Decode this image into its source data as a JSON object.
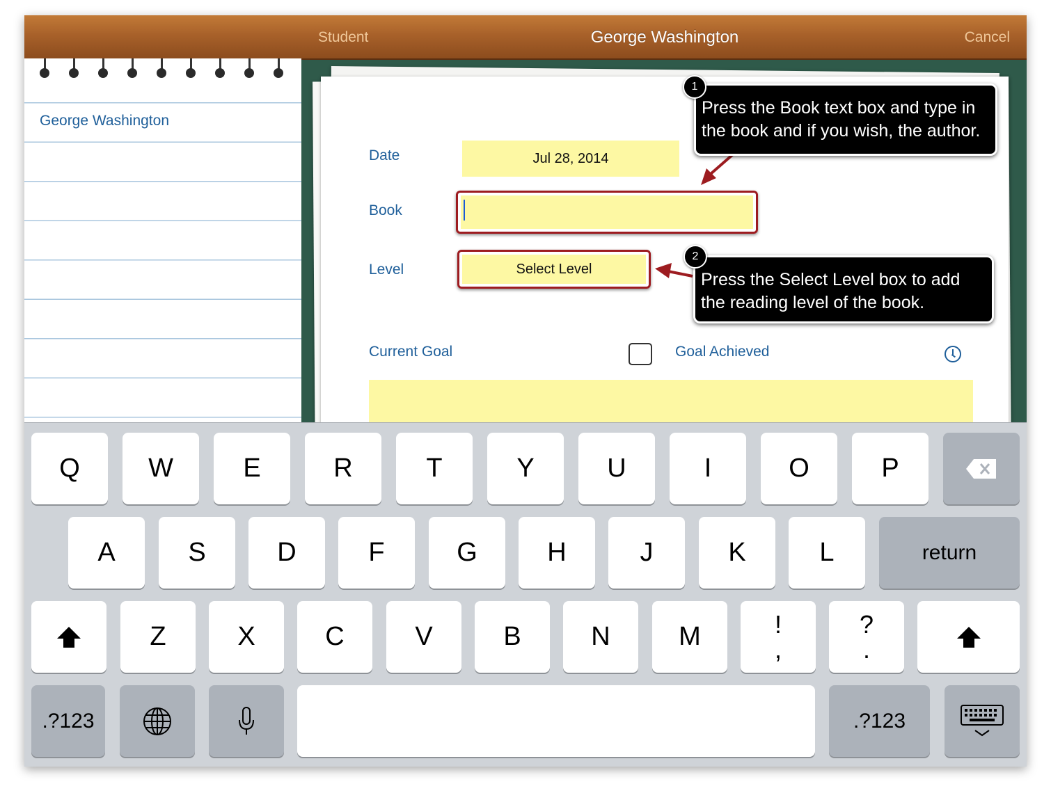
{
  "navbar": {
    "back_label": "Student",
    "title": "George Washington",
    "cancel_label": "Cancel"
  },
  "sidebar": {
    "items": [
      {
        "label": "George Washington"
      }
    ]
  },
  "form": {
    "date_label": "Date",
    "date_value": "Jul 28, 2014",
    "book_label": "Book",
    "book_value": "",
    "level_label": "Level",
    "level_value": "Select Level",
    "current_goal_label": "Current Goal",
    "goal_achieved_label": "Goal Achieved",
    "goal_achieved_checked": false
  },
  "callouts": [
    {
      "number": "1",
      "text": "Press the Book text box and type in the book and if you wish, the author."
    },
    {
      "number": "2",
      "text": "Press the Select Level box to add the reading level of the book."
    }
  ],
  "keyboard": {
    "row1": [
      "Q",
      "W",
      "E",
      "R",
      "T",
      "Y",
      "U",
      "I",
      "O",
      "P"
    ],
    "row2": [
      "A",
      "S",
      "D",
      "F",
      "G",
      "H",
      "J",
      "K",
      "L"
    ],
    "row3": [
      "Z",
      "X",
      "C",
      "V",
      "B",
      "N",
      "M"
    ],
    "return_label": "return",
    "punct1": [
      "!",
      ","
    ],
    "punct2": [
      "?",
      "."
    ],
    "numbers_label": ".?123",
    "icons": {
      "backspace": "backspace-icon",
      "shift": "shift-icon",
      "globe": "globe-icon",
      "mic": "microphone-icon",
      "dismiss": "keyboard-dismiss-icon"
    }
  },
  "colors": {
    "accent_blue": "#1f5f9a",
    "highlight_red": "#9d1c20",
    "field_yellow": "#fdf8a3",
    "wood": "#a8612a",
    "chalkboard": "#2f5a4a"
  }
}
